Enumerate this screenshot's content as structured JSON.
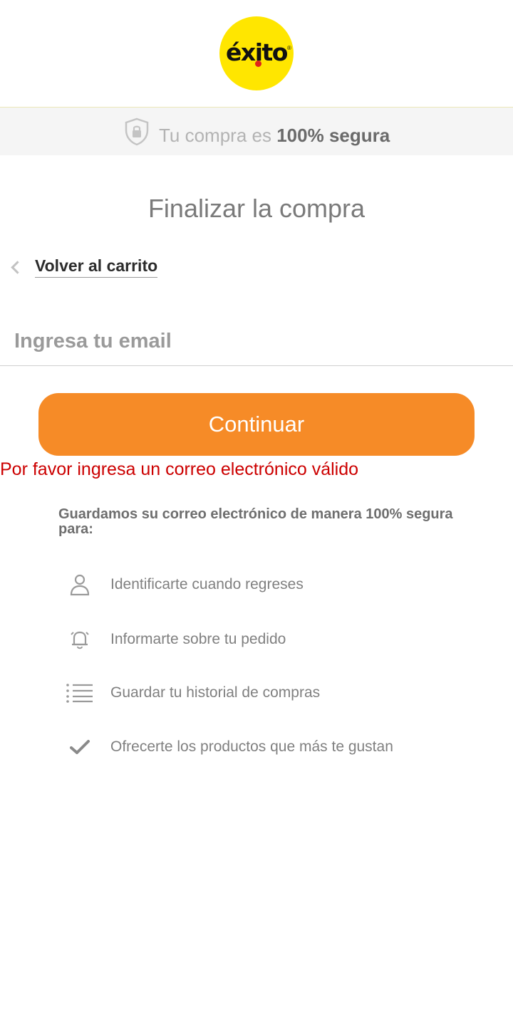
{
  "header": {
    "logo_text": "éxito",
    "logo_mark": "®",
    "logo_colors": {
      "circle": "#ffe600",
      "dot": "#e0231a"
    }
  },
  "secure_band": {
    "icon": "shield-lock-icon",
    "text_prefix": "Tu compra es ",
    "text_bold": "100% segura"
  },
  "page": {
    "title": "Finalizar la compra",
    "back_link": "Volver al carrito"
  },
  "email": {
    "value": "",
    "placeholder": "Ingresa tu email"
  },
  "continue_button": {
    "label": "Continuar",
    "color": "#f68b27"
  },
  "error_message": "Por favor ingresa un correo electrónico válido",
  "benefits": {
    "title": "Guardamos su correo electrónico de manera 100% segura para:",
    "items": [
      {
        "icon": "user-icon",
        "label": "Identificarte cuando regreses"
      },
      {
        "icon": "bell-icon",
        "label": "Informarte sobre tu pedido"
      },
      {
        "icon": "list-icon",
        "label": "Guardar tu historial de compras"
      },
      {
        "icon": "checkmark-icon",
        "label": "Ofrecerte los productos que más te gustan"
      }
    ]
  }
}
